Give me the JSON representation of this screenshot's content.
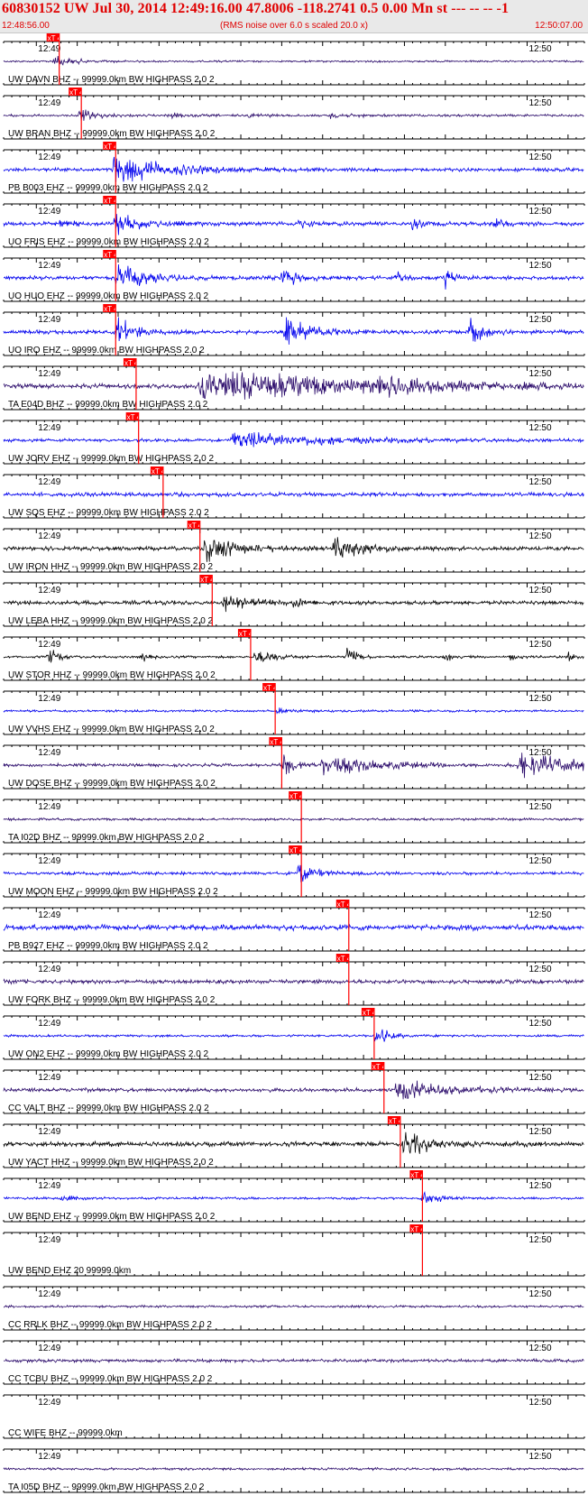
{
  "header": {
    "title": "60830152 UW Jul 30, 2014 12:49:16.00   47.8006 -118.2741  0.5 0.00 Mn st --- -- --  -1",
    "start_time": "12:48:56.00",
    "rms_note": "(RMS noise over 6.0 s scaled 20.0 x)",
    "end_time": "12:50:07.00"
  },
  "colors": {
    "accent": "#e00000",
    "pick_bg": "#ff0000",
    "trace_blue": "#0000ee",
    "trace_indigo": "#2a0a6a",
    "trace_black": "#000000"
  },
  "chart_data": {
    "type": "seismogram",
    "time_start": "12:48:56.00",
    "time_end": "12:50:07.00",
    "duration_s": 71,
    "tick_labels": [
      {
        "t": 4,
        "label": "12:49"
      },
      {
        "t": 64,
        "label": "12:50"
      }
    ],
    "pick_label": "xT 4",
    "channels": [
      {
        "label": "UW DAVN BHZ -- 99999.0km BW  HIGHPASS  2.0  2",
        "color": "trace_indigo",
        "pick": 6.8,
        "noise": 1.2,
        "events": [
          {
            "t": 6.2,
            "amp": 6,
            "dur": 2.5
          }
        ]
      },
      {
        "label": "UW BRAN BHZ -- 99999.0km BW  HIGHPASS  2.0  2",
        "color": "trace_indigo",
        "pick": 9.5,
        "noise": 1.5,
        "events": [
          {
            "t": 9.3,
            "amp": 8,
            "dur": 1.8
          },
          {
            "t": 20,
            "amp": 3,
            "dur": 2
          },
          {
            "t": 30,
            "amp": 3,
            "dur": 1.5
          },
          {
            "t": 40,
            "amp": 3,
            "dur": 2.5
          }
        ]
      },
      {
        "label": "PB B003 EHZ -- 99999.0km BW  HIGHPASS  2.0  2",
        "color": "trace_blue",
        "pick": 13.7,
        "noise": 2.2,
        "events": [
          {
            "t": 13.5,
            "amp": 18,
            "dur": 6
          }
        ]
      },
      {
        "label": "UO FRIS EHZ -- 99999.0km BW  HIGHPASS  2.0  2",
        "color": "trace_blue",
        "pick": 13.7,
        "noise": 2.5,
        "events": [
          {
            "t": 13.7,
            "amp": 14,
            "dur": 2.5
          },
          {
            "t": 7,
            "amp": 6,
            "dur": 1
          },
          {
            "t": 36,
            "amp": 6,
            "dur": 1
          },
          {
            "t": 50,
            "amp": 6,
            "dur": 1
          },
          {
            "t": 60,
            "amp": 6,
            "dur": 1
          }
        ]
      },
      {
        "label": "UO HUO EHZ -- 99999.0km BW  HIGHPASS  2.0  2",
        "color": "trace_blue",
        "pick": 13.7,
        "noise": 2.5,
        "events": [
          {
            "t": 13.8,
            "amp": 18,
            "dur": 3
          },
          {
            "t": 34,
            "amp": 16,
            "dur": 1.5
          },
          {
            "t": 48,
            "amp": 8,
            "dur": 1
          },
          {
            "t": 54,
            "amp": 14,
            "dur": 1
          }
        ]
      },
      {
        "label": "UO IRO EHZ -- 99999.0km BW  HIGHPASS  2.0  2",
        "color": "trace_blue",
        "pick": 13.7,
        "noise": 2.5,
        "events": [
          {
            "t": 13.9,
            "amp": 18,
            "dur": 2
          },
          {
            "t": 34.5,
            "amp": 20,
            "dur": 2.5
          },
          {
            "t": 57,
            "amp": 16,
            "dur": 1.5
          }
        ]
      },
      {
        "label": "TA E04D BHZ -- 99999.0km BW  HIGHPASS  2.0  2",
        "color": "trace_indigo",
        "pick": 16.2,
        "noise": 3,
        "events": [
          {
            "t": 24,
            "amp": 20,
            "dur": 18
          },
          {
            "t": 46,
            "amp": 9,
            "dur": 4
          }
        ]
      },
      {
        "label": "UW JORV EHZ -- 99999.0km BW  HIGHPASS  2.0  2",
        "color": "trace_blue",
        "pick": 16.5,
        "noise": 2,
        "events": [
          {
            "t": 28,
            "amp": 12,
            "dur": 10
          }
        ]
      },
      {
        "label": "UW SQS EHZ -- 99999.0km BW  HIGHPASS  2.0  2",
        "color": "trace_blue",
        "pick": 19.5,
        "noise": 2.5,
        "events": []
      },
      {
        "label": "UW IRON HHZ -- 99999.0km BW  HIGHPASS  2.0  2",
        "color": "trace_black",
        "pick": 24,
        "noise": 2.5,
        "events": [
          {
            "t": 24.5,
            "amp": 16,
            "dur": 4
          },
          {
            "t": 40.5,
            "amp": 14,
            "dur": 3
          }
        ]
      },
      {
        "label": "UW LEBA HHZ -- 99999.0km BW  HIGHPASS  2.0  2",
        "color": "trace_black",
        "pick": 25.5,
        "noise": 2.5,
        "events": [
          {
            "t": 27,
            "amp": 10,
            "dur": 3
          },
          {
            "t": 35.5,
            "amp": 6,
            "dur": 1.5
          }
        ]
      },
      {
        "label": "UW STOR HHZ -- 99999.0km BW  HIGHPASS  2.0  2",
        "color": "trace_black",
        "pick": 30.2,
        "noise": 1.5,
        "events": [
          {
            "t": 5.5,
            "amp": 12,
            "dur": 1.2
          },
          {
            "t": 17,
            "amp": 6,
            "dur": 0.8
          },
          {
            "t": 30.8,
            "amp": 10,
            "dur": 2
          },
          {
            "t": 42,
            "amp": 12,
            "dur": 1
          },
          {
            "t": 54,
            "amp": 6,
            "dur": 0.8
          },
          {
            "t": 62,
            "amp": 5,
            "dur": 0.8
          },
          {
            "t": 69,
            "amp": 6,
            "dur": 0.8
          }
        ]
      },
      {
        "label": "UW VVHS EHZ -- 99999.0km BW  HIGHPASS  2.0  2",
        "color": "trace_blue",
        "pick": 33.2,
        "noise": 1.5,
        "events": [
          {
            "t": 33.5,
            "amp": 3,
            "dur": 2
          }
        ]
      },
      {
        "label": "UW DOSE BHZ -- 99999.0km BW  HIGHPASS  2.0  2",
        "color": "trace_indigo",
        "pick": 34,
        "noise": 2,
        "events": [
          {
            "t": 34.2,
            "amp": 14,
            "dur": 1.5
          },
          {
            "t": 39,
            "amp": 13,
            "dur": 6
          },
          {
            "t": 63,
            "amp": 14,
            "dur": 8
          }
        ]
      },
      {
        "label": "TA I02D BHZ -- 99999.0km BW  HIGHPASS  2.0  2",
        "color": "trace_indigo",
        "pick": 36.4,
        "noise": 1.5,
        "events": []
      },
      {
        "label": "UW MOON EHZ -- 99999.0km BW  HIGHPASS  2.0  2",
        "color": "trace_blue",
        "pick": 36.4,
        "noise": 2,
        "events": [
          {
            "t": 36.1,
            "amp": 14,
            "dur": 1.8
          }
        ]
      },
      {
        "label": "PB B927 EHZ -- 99999.0km BW  HIGHPASS  2.0  2",
        "color": "trace_blue",
        "pick": 42.2,
        "noise": 3.5,
        "events": []
      },
      {
        "label": "UW FORK BHZ -- 99999.0km BW  HIGHPASS  2.0  2",
        "color": "trace_indigo",
        "pick": 42.2,
        "noise": 2.5,
        "events": []
      },
      {
        "label": "UW ON2 EHZ -- 99999.0km BW  HIGHPASS  2.0  2",
        "color": "trace_blue",
        "pick": 45.3,
        "noise": 1.5,
        "events": [
          {
            "t": 45.5,
            "amp": 12,
            "dur": 1.5
          }
        ]
      },
      {
        "label": "CC VALT BHZ -- 99999.0km BW  HIGHPASS  2.0  2",
        "color": "trace_indigo",
        "pick": 46.5,
        "noise": 2.5,
        "events": [
          {
            "t": 48,
            "amp": 14,
            "dur": 5
          }
        ]
      },
      {
        "label": "UW YACT HHZ -- 99999.0km BW  HIGHPASS  2.0  2",
        "color": "trace_black",
        "pick": 48.5,
        "noise": 3,
        "events": [
          {
            "t": 49,
            "amp": 16,
            "dur": 3
          }
        ]
      },
      {
        "label": "UW BEND EHZ -- 99999.0km BW  HIGHPASS  2.0  2",
        "color": "trace_blue",
        "pick": 51.2,
        "noise": 1.5,
        "events": [
          {
            "t": 7,
            "amp": 4,
            "dur": 1.5
          },
          {
            "t": 51.3,
            "amp": 10,
            "dur": 1.5
          }
        ]
      },
      {
        "label": "UW BEND EHZ 20 99999.0km",
        "color": "trace_blue",
        "pick": 51.2,
        "noise": 0,
        "events": []
      },
      {
        "label": "CC RRLK BHZ -- 99999.0km BW  HIGHPASS  2.0  2",
        "color": "trace_indigo",
        "pick": null,
        "noise": 1.5,
        "events": []
      },
      {
        "label": "CC TCBU BHZ -- 99999.0km BW  HIGHPASS  2.0  2",
        "color": "trace_indigo",
        "pick": null,
        "noise": 2,
        "events": []
      },
      {
        "label": "CC WIFE BHZ -- 99999.0km",
        "color": "trace_indigo",
        "pick": null,
        "noise": 0,
        "events": []
      },
      {
        "label": "TA I05D BHZ -- 99999.0km BW  HIGHPASS  2.0  2",
        "color": "trace_indigo",
        "pick": null,
        "noise": 1.5,
        "events": []
      }
    ]
  }
}
